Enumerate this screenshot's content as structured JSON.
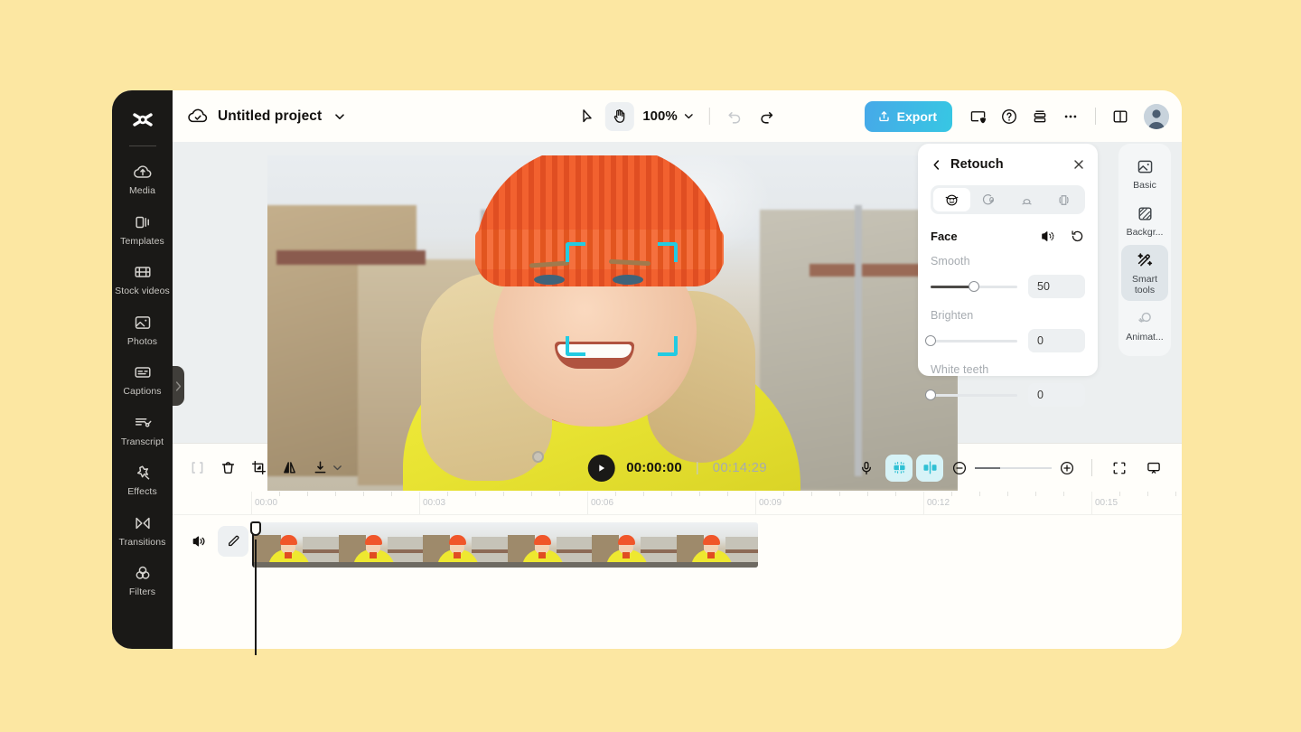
{
  "theme": {
    "page_background": "#FCE7A2",
    "app_background": "#FFFEFA",
    "rail_background": "#1A1917",
    "accent_cyan": "#22CBE2",
    "export_gradient_from": "#46A9E8",
    "export_gradient_to": "#37C7E3",
    "stage_background": "#ECEFF0"
  },
  "sidebar": {
    "logo": "capcut-logo-icon",
    "items": [
      {
        "icon": "media-upload-icon",
        "label": "Media"
      },
      {
        "icon": "templates-icon",
        "label": "Templates"
      },
      {
        "icon": "film-strip-icon",
        "label": "Stock\nvideos"
      },
      {
        "icon": "photos-icon",
        "label": "Photos"
      },
      {
        "icon": "captions-icon",
        "label": "Captions"
      },
      {
        "icon": "transcript-icon",
        "label": "Transcript"
      },
      {
        "icon": "effects-star-icon",
        "label": "Effects"
      },
      {
        "icon": "transitions-icon",
        "label": "Transitions"
      },
      {
        "icon": "filters-icon",
        "label": "Filters"
      }
    ],
    "collapse_handle": "chevron-right-icon"
  },
  "topbar": {
    "cloud_icon": "cloud-check-icon",
    "project_title": "Untitled project",
    "title_caret": "chevron-down-icon",
    "tools": [
      {
        "name": "select-tool",
        "icon": "cursor-arrow-icon",
        "active": false
      },
      {
        "name": "hand-tool",
        "icon": "hand-icon",
        "active": true
      }
    ],
    "zoom_value": "100%",
    "zoom_caret": "chevron-down-icon",
    "undo_icon": "undo-icon",
    "redo_icon": "redo-icon",
    "export_label": "Export",
    "export_icon": "upload-icon",
    "actions": [
      {
        "name": "privacy-button",
        "icon": "shield-screen-icon"
      },
      {
        "name": "help-button",
        "icon": "question-circle-icon"
      },
      {
        "name": "layers-button",
        "icon": "stack-icon"
      },
      {
        "name": "more-button",
        "icon": "ellipsis-icon"
      },
      {
        "name": "layout-button",
        "icon": "split-layout-icon"
      }
    ],
    "avatar": "user-avatar"
  },
  "retouch_panel": {
    "back_icon": "chevron-left-icon",
    "title": "Retouch",
    "close_icon": "close-icon",
    "tabs": [
      {
        "name": "face-tab",
        "icon": "face-smile-icon",
        "active": true
      },
      {
        "name": "eyes-tab",
        "icon": "eye-shape-icon",
        "active": false
      },
      {
        "name": "nose-tab",
        "icon": "nose-shape-icon",
        "active": false
      },
      {
        "name": "body-tab",
        "icon": "body-shape-icon",
        "active": false
      }
    ],
    "section_label": "Face",
    "compare_icon": "compare-icon",
    "reset_icon": "reset-icon",
    "sliders": [
      {
        "label": "Smooth",
        "value": "50",
        "percent": 50
      },
      {
        "label": "Brighten",
        "value": "0",
        "percent": 0
      },
      {
        "label": "White teeth",
        "value": "0",
        "percent": 0
      }
    ]
  },
  "tool_dock": {
    "items": [
      {
        "icon": "image-basic-icon",
        "label": "Basic",
        "active": false
      },
      {
        "icon": "background-icon",
        "label": "Backgr...",
        "active": false
      },
      {
        "icon": "magic-wand-icon",
        "label": "Smart\ntools",
        "active": true
      },
      {
        "icon": "animation-icon",
        "label": "Animat...",
        "active": false
      }
    ]
  },
  "timeline": {
    "left_tools": [
      {
        "name": "split-button",
        "icon": "split-icon"
      },
      {
        "name": "delete-button",
        "icon": "trash-icon"
      },
      {
        "name": "crop-button",
        "icon": "crop-icon"
      },
      {
        "name": "mirror-button",
        "icon": "mirror-icon"
      },
      {
        "name": "download-button",
        "icon": "download-icon"
      },
      {
        "name": "download-caret",
        "icon": "chevron-down-icon"
      }
    ],
    "play_icon": "play-icon",
    "current_time": "00:00:00",
    "time_separator": "|",
    "total_time": "00:14:29",
    "right_tools": [
      {
        "name": "record-voice-button",
        "icon": "microphone-icon",
        "highlighted": false
      },
      {
        "name": "auto-cut-button",
        "icon": "auto-cut-icon",
        "highlighted": true
      },
      {
        "name": "split-view-button",
        "icon": "split-clip-icon",
        "highlighted": true
      }
    ],
    "zoom_out_icon": "minus-circle-icon",
    "zoom_in_icon": "plus-circle-icon",
    "fit_icon": "fit-screen-icon",
    "preview_icon": "monitor-icon",
    "ruler_labels": [
      "00:00",
      "00:03",
      "00:06",
      "00:09",
      "00:12",
      "00:15"
    ],
    "track": {
      "volume_icon": "speaker-icon",
      "edit_icon": "pencil-icon",
      "clip_name": "video-clip",
      "thumbnail_count": 6
    },
    "playhead_position": "00:00:00"
  },
  "canvas": {
    "face_detection_box": "face-detection-overlay",
    "frame_label": "video-preview"
  }
}
